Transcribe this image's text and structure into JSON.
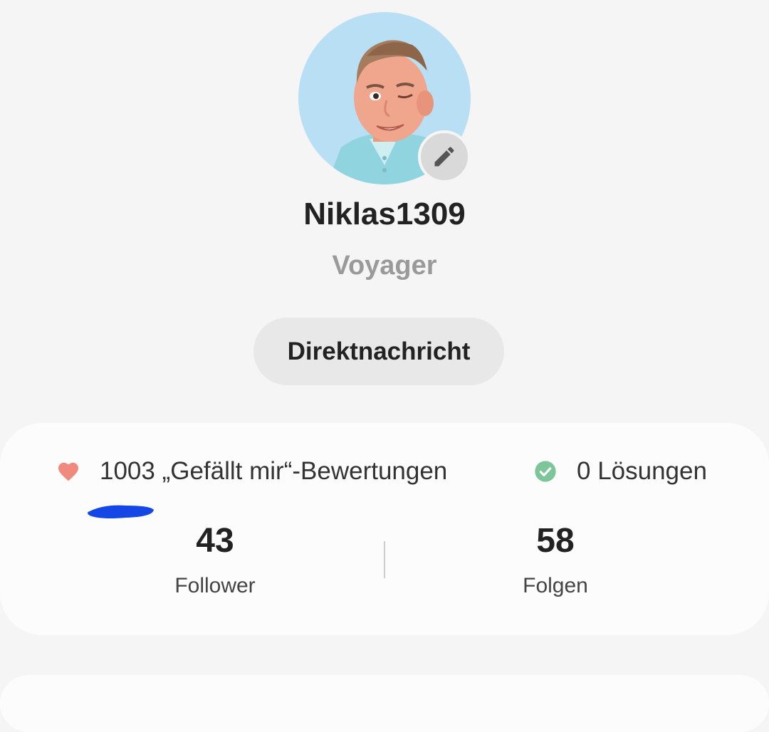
{
  "profile": {
    "username": "Niklas1309",
    "rank": "Voyager",
    "avatar_icon": "avatar-image",
    "edit_icon": "pencil-icon"
  },
  "actions": {
    "direct_message_label": "Direktnachricht"
  },
  "stats": {
    "likes_text": "1003 „Gefällt mir“-Bewertungen",
    "solutions_text": "0 Lösungen",
    "followers_count": "43",
    "followers_label": "Follower",
    "following_count": "58",
    "following_label": "Folgen"
  },
  "colors": {
    "heart": "#f08a7e",
    "check": "#7cc69a",
    "scribble": "#1447e6"
  }
}
